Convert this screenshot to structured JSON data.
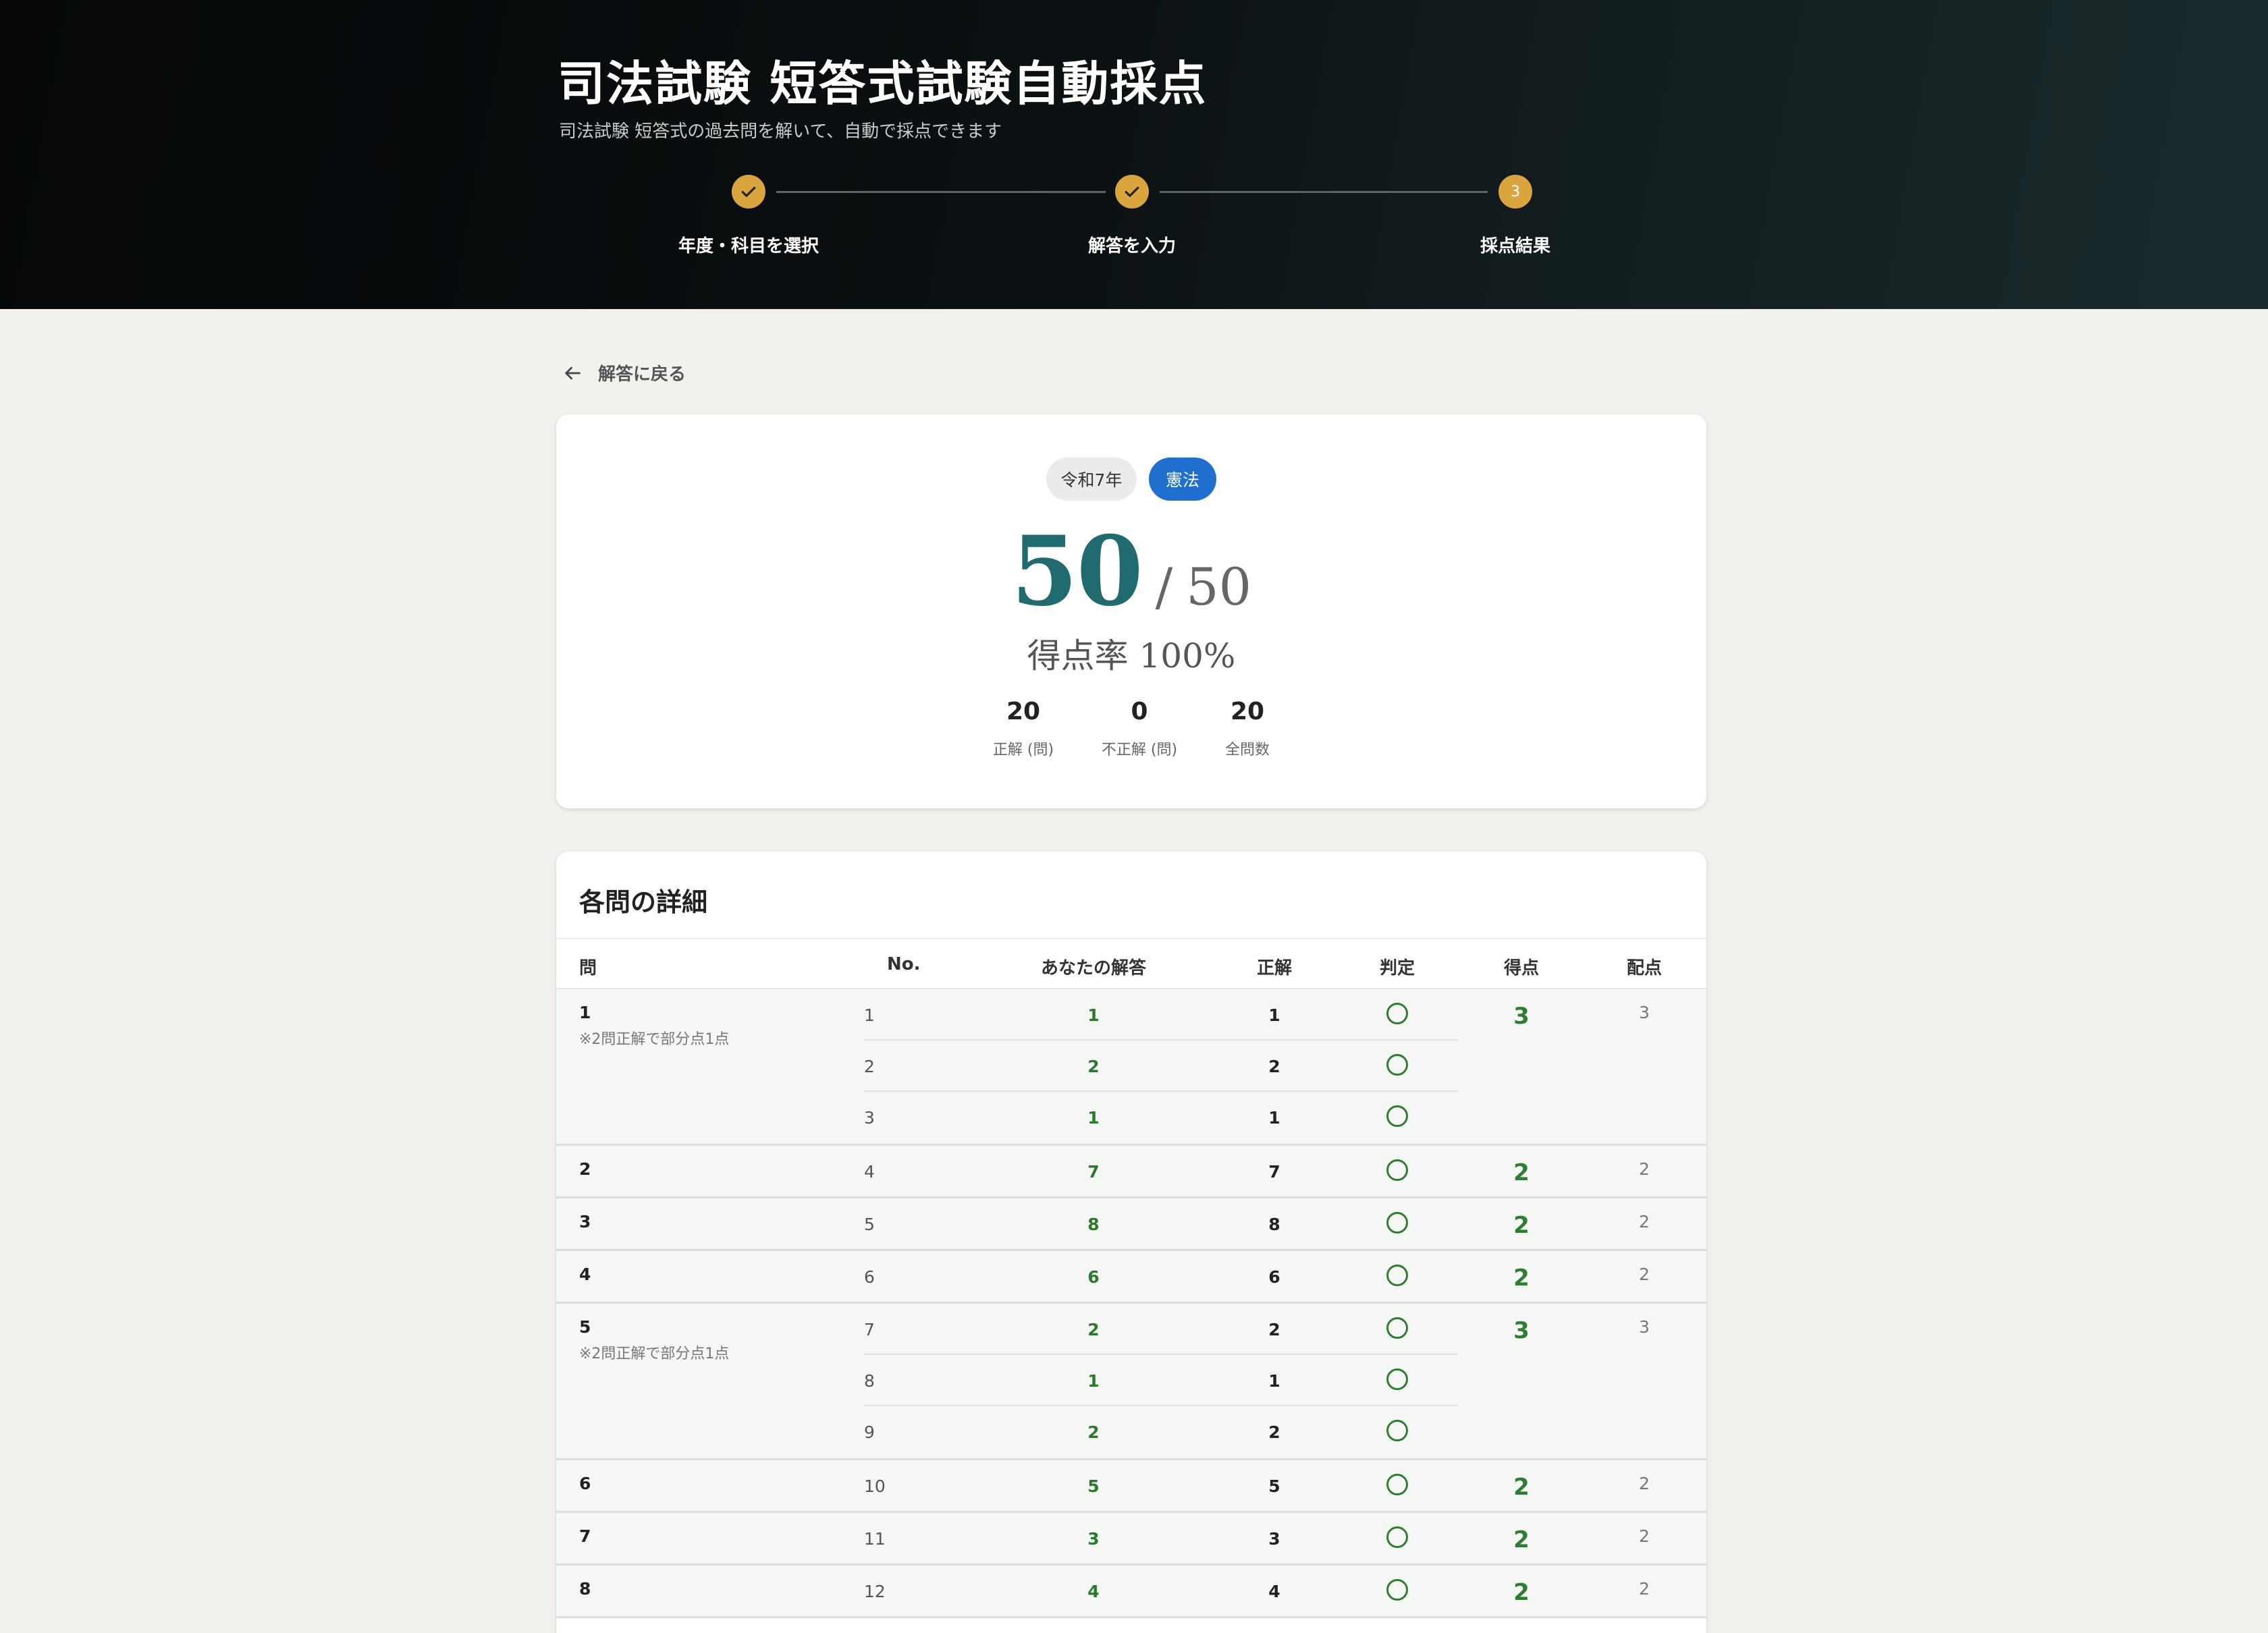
{
  "header": {
    "title": "司法試験 短答式試験自動採点",
    "subtitle": "司法試験 短答式の過去問を解いて、自動で採点できます",
    "steps": [
      {
        "label": "年度・科目を選択",
        "state": "done"
      },
      {
        "label": "解答を入力",
        "state": "done"
      },
      {
        "label": "採点結果",
        "state": "current",
        "number": "3"
      }
    ]
  },
  "back_link": "解答に戻る",
  "summary": {
    "year_chip": "令和7年",
    "subject_chip": "憲法",
    "score": "50",
    "separator": "/",
    "total": "50",
    "rate_text": "得点率 100%",
    "stats": [
      {
        "value": "20",
        "label": "正解 (問)"
      },
      {
        "value": "0",
        "label": "不正解 (問)"
      },
      {
        "value": "20",
        "label": "全問数"
      }
    ]
  },
  "detail": {
    "title": "各問の詳細",
    "columns": [
      "問",
      "No.",
      "あなたの解答",
      "正解",
      "判定",
      "得点",
      "配点"
    ],
    "questions": [
      {
        "q": "1",
        "note": "※2問正解で部分点1点",
        "score": "3",
        "max": "3",
        "rows": [
          {
            "no": "1",
            "answer": "1",
            "correct": "1"
          },
          {
            "no": "2",
            "answer": "2",
            "correct": "2"
          },
          {
            "no": "3",
            "answer": "1",
            "correct": "1"
          }
        ]
      },
      {
        "q": "2",
        "note": "",
        "score": "2",
        "max": "2",
        "rows": [
          {
            "no": "4",
            "answer": "7",
            "correct": "7"
          }
        ]
      },
      {
        "q": "3",
        "note": "",
        "score": "2",
        "max": "2",
        "rows": [
          {
            "no": "5",
            "answer": "8",
            "correct": "8"
          }
        ]
      },
      {
        "q": "4",
        "note": "",
        "score": "2",
        "max": "2",
        "rows": [
          {
            "no": "6",
            "answer": "6",
            "correct": "6"
          }
        ]
      },
      {
        "q": "5",
        "note": "※2問正解で部分点1点",
        "score": "3",
        "max": "3",
        "rows": [
          {
            "no": "7",
            "answer": "2",
            "correct": "2"
          },
          {
            "no": "8",
            "answer": "1",
            "correct": "1"
          },
          {
            "no": "9",
            "answer": "2",
            "correct": "2"
          }
        ]
      },
      {
        "q": "6",
        "note": "",
        "score": "2",
        "max": "2",
        "rows": [
          {
            "no": "10",
            "answer": "5",
            "correct": "5"
          }
        ]
      },
      {
        "q": "7",
        "note": "",
        "score": "2",
        "max": "2",
        "rows": [
          {
            "no": "11",
            "answer": "3",
            "correct": "3"
          }
        ]
      },
      {
        "q": "8",
        "note": "",
        "score": "2",
        "max": "2",
        "rows": [
          {
            "no": "12",
            "answer": "4",
            "correct": "4"
          }
        ]
      }
    ]
  },
  "colors": {
    "accent_gold": "#d9a53c",
    "score_teal": "#1f6b6f",
    "chip_blue": "#1f6fcf",
    "correct_green": "#2e7d32"
  }
}
